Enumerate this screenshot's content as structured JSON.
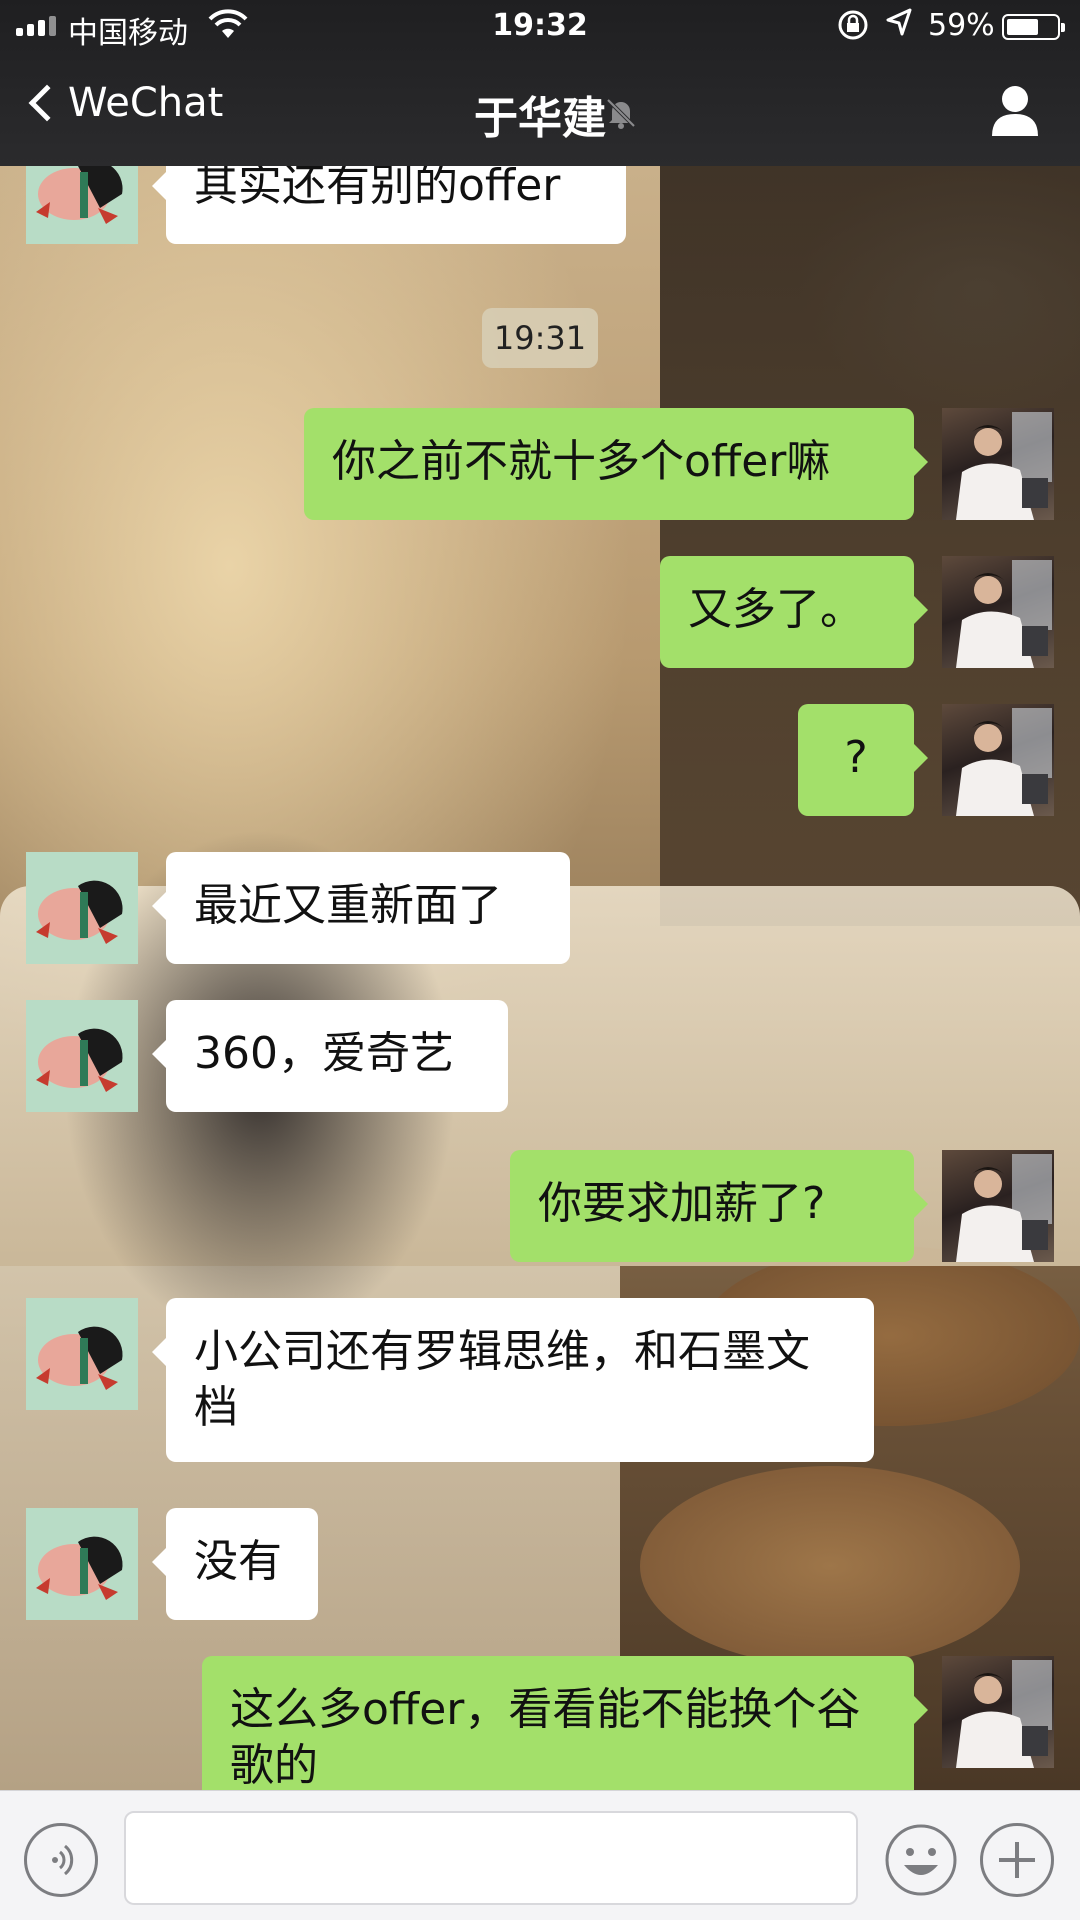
{
  "status_bar": {
    "carrier": "中国移动",
    "time": "19:32",
    "battery": "59%",
    "battery_level": 0.59
  },
  "nav": {
    "back_label": "WeChat",
    "title": "于华建",
    "muted": true
  },
  "chat": {
    "timestamp": "19:31",
    "messages": [
      {
        "from": "other",
        "text": "其实还有别的offer"
      },
      {
        "from": "me",
        "text": "你之前不就十多个offer嘛"
      },
      {
        "from": "me",
        "text": "又多了。"
      },
      {
        "from": "me",
        "text": "?"
      },
      {
        "from": "other",
        "text": "最近又重新面了"
      },
      {
        "from": "other",
        "text": "360，爱奇艺"
      },
      {
        "from": "me",
        "text": "你要求加薪了?"
      },
      {
        "from": "other",
        "text": "小公司还有罗辑思维，和石墨文档"
      },
      {
        "from": "other",
        "text": "没有"
      },
      {
        "from": "me",
        "text": "这么多offer，看看能不能换个谷歌的"
      }
    ]
  },
  "input_bar": {
    "text": ""
  }
}
